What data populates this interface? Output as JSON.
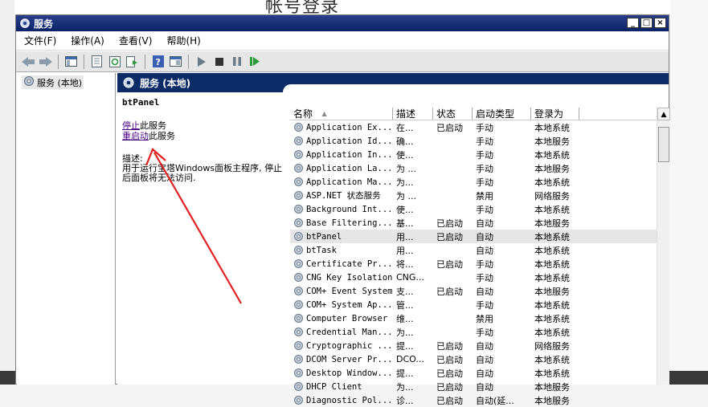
{
  "background": {
    "title": "帐号登录"
  },
  "window": {
    "title": "服务",
    "menu": [
      "文件(F)",
      "操作(A)",
      "查看(V)",
      "帮助(H)"
    ],
    "tree_item": "服务 (本地)",
    "pane_header": "服务 (本地)"
  },
  "detail": {
    "service_name": "btPanel",
    "stop_link": "停止",
    "stop_suffix": "此服务",
    "restart_link": "重启动",
    "restart_suffix": "此服务",
    "desc_label": "描述:",
    "desc_text": "用于运行宝塔Windows面板主程序, 停止后面板将无法访问."
  },
  "table": {
    "columns": [
      "名称",
      "描述",
      "状态",
      "启动类型",
      "登录为"
    ],
    "sort_indicator": "▲",
    "rows": [
      [
        "Application Ex...",
        "在...",
        "已启动",
        "手动",
        "本地系统"
      ],
      [
        "Application Id...",
        "确...",
        "",
        "手动",
        "本地服务"
      ],
      [
        "Application In...",
        "使...",
        "",
        "手动",
        "本地系统"
      ],
      [
        "Application La...",
        "为 ...",
        "",
        "手动",
        "本地服务"
      ],
      [
        "Application Ma...",
        "为...",
        "",
        "手动",
        "本地系统"
      ],
      [
        "ASP.NET 状态服务",
        "为 ...",
        "",
        "禁用",
        "网络服务"
      ],
      [
        "Background Int...",
        "使...",
        "",
        "手动",
        "本地系统"
      ],
      [
        "Base Filtering...",
        "基...",
        "已启动",
        "自动",
        "本地服务"
      ],
      [
        "btPanel",
        "用...",
        "已启动",
        "自动",
        "本地系统"
      ],
      [
        "btTask",
        "用...",
        "",
        "自动",
        "本地系统"
      ],
      [
        "Certificate Pr...",
        "将...",
        "已启动",
        "手动",
        "本地系统"
      ],
      [
        "CNG Key Isolation",
        "CNG...",
        "",
        "手动",
        "本地系统"
      ],
      [
        "COM+ Event System",
        "支...",
        "已启动",
        "自动",
        "本地服务"
      ],
      [
        "COM+ System Ap...",
        "管...",
        "",
        "手动",
        "本地系统"
      ],
      [
        "Computer Browser",
        "维...",
        "",
        "禁用",
        "本地系统"
      ],
      [
        "Credential Man...",
        "为...",
        "",
        "手动",
        "本地系统"
      ],
      [
        "Cryptographic ...",
        "提...",
        "已启动",
        "自动",
        "网络服务"
      ],
      [
        "DCOM Server Pr...",
        "DCO...",
        "已启动",
        "自动",
        "本地系统"
      ],
      [
        "Desktop Window...",
        "提...",
        "已启动",
        "自动",
        "本地系统"
      ],
      [
        "DHCP Client",
        "为...",
        "已启动",
        "自动",
        "本地服务"
      ],
      [
        "Diagnostic Pol...",
        "诊...",
        "已启动",
        "自动(延...",
        "本地服务"
      ]
    ],
    "selected_index": 8
  },
  "colors": {
    "title_bar": "#0b2266",
    "pane_header": "#0c2b67",
    "arrow": "#e02020",
    "link": "#4b0082"
  }
}
